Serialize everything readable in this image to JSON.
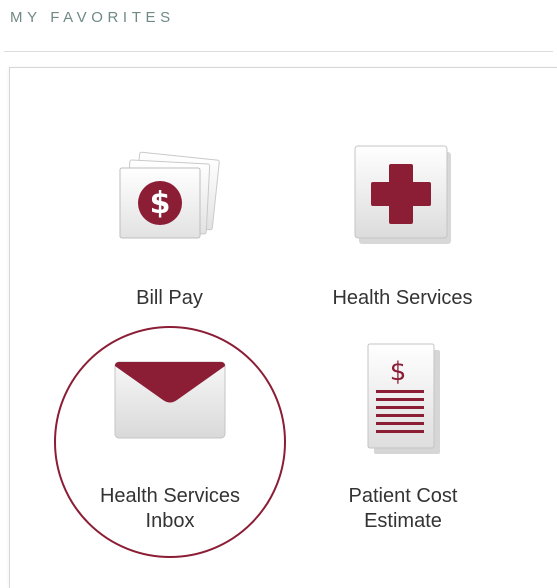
{
  "section": {
    "title": "MY FAVORITES"
  },
  "favorites": [
    {
      "label": "Bill Pay",
      "icon": "dollar-bills-icon"
    },
    {
      "label": "Health Services",
      "icon": "red-cross-icon"
    },
    {
      "label": "Health Services\nInbox",
      "icon": "envelope-icon"
    },
    {
      "label": "Patient Cost\nEstimate",
      "icon": "price-list-icon"
    }
  ],
  "colors": {
    "accent": "#8b1d35",
    "label": "#333333",
    "title": "#6f8a86"
  }
}
